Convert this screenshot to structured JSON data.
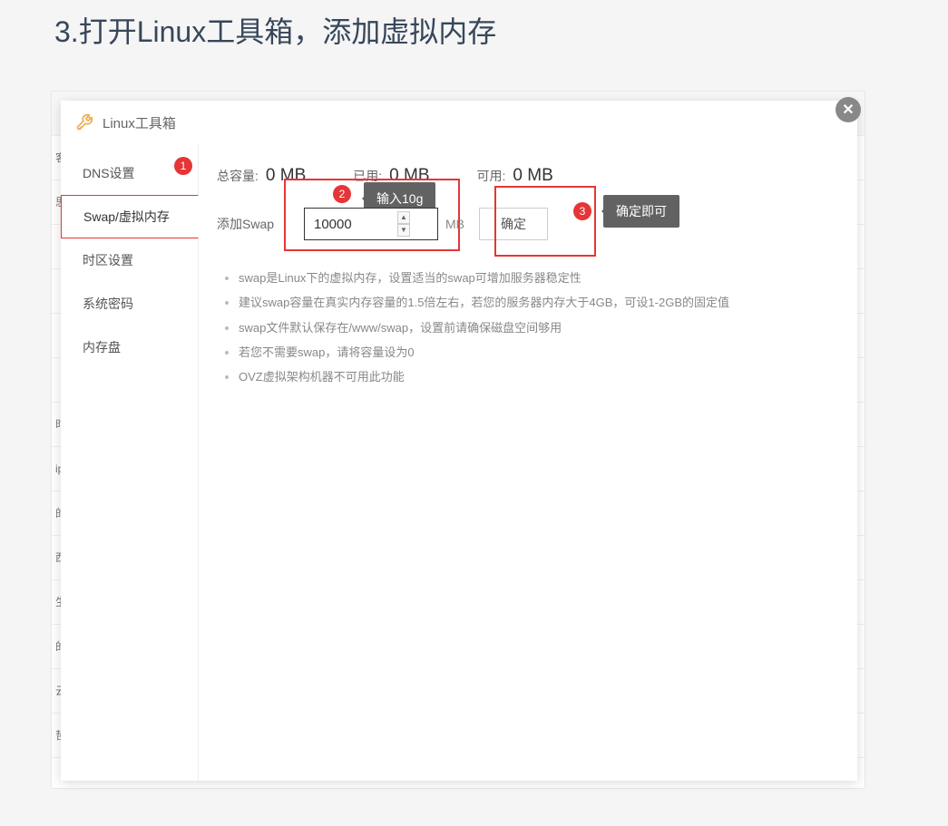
{
  "heading": "3.打开Linux工具箱，添加虚拟内存",
  "dialog": {
    "title": "Linux工具箱",
    "close": "✕"
  },
  "sidebar": {
    "items": [
      {
        "label": "DNS设置"
      },
      {
        "label": "Swap/虚拟内存"
      },
      {
        "label": "时区设置"
      },
      {
        "label": "系统密码"
      },
      {
        "label": "内存盘"
      }
    ]
  },
  "stats": {
    "total_label": "总容量:",
    "total_value": "0 MB",
    "used_label": "已用:",
    "used_value": "0 MB",
    "avail_label": "可用:",
    "avail_value": "0 MB"
  },
  "swap": {
    "label": "添加Swap",
    "value": "10000",
    "unit": "MB",
    "confirm": "确定"
  },
  "annotations": {
    "b1": "1",
    "b2": "2",
    "b3": "3",
    "tip2": "输入10g",
    "tip3": "确定即可"
  },
  "tips": [
    "swap是Linux下的虚拟内存，设置适当的swap可增加服务器稳定性",
    "建议swap容量在真实内存容量的1.5倍左右，若您的服务器内存大于4GB，可设1-2GB的固定值",
    "swap文件默认保存在/www/swap，设置前请确保磁盘空间够用",
    "若您不需要swap，请将容量设为0",
    "OVZ虚拟架构机器不可用此功能"
  ],
  "bg_rows": [
    "",
    "客",
    "思",
    "",
    "",
    "",
    "",
    "时",
    "ip",
    "的",
    "西",
    "生",
    "的",
    "云",
    "哲"
  ]
}
